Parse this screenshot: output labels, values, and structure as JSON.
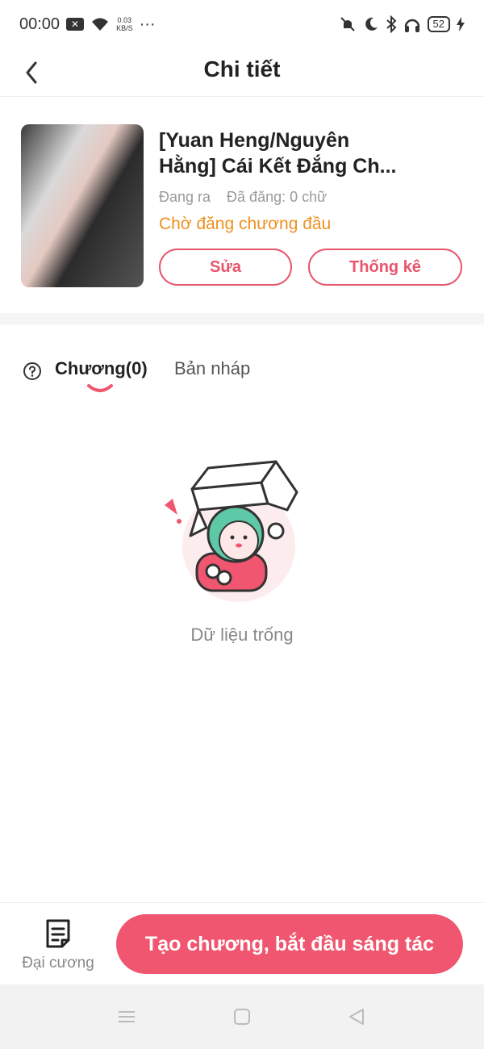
{
  "status_bar": {
    "time": "00:00",
    "speed_value": "0.03",
    "speed_unit": "KB/S",
    "more": "···",
    "battery": "52"
  },
  "header": {
    "title": "Chi tiết",
    "back_icon": "chevron-left-icon"
  },
  "book": {
    "title_line1": "[Yuan Heng/Nguyên",
    "title_line2": "Hằng] Cái Kết Đắng Ch...",
    "state": "Đang ra",
    "posted": "Đã đăng: 0 chữ",
    "status": "Chờ đăng chương đầu",
    "edit_label": "Sửa",
    "stats_label": "Thống kê"
  },
  "tabs": {
    "chapters": "Chương(0)",
    "drafts": "Bản nháp",
    "help_icon": "question-circle-icon"
  },
  "empty": {
    "text": "Dữ liệu trống"
  },
  "bottom": {
    "outline_label": "Đại cương",
    "create_label": "Tạo chương, bắt đầu sáng tác"
  },
  "colors": {
    "accent": "#f0566f",
    "warning": "#f0901f",
    "muted": "#888888"
  }
}
